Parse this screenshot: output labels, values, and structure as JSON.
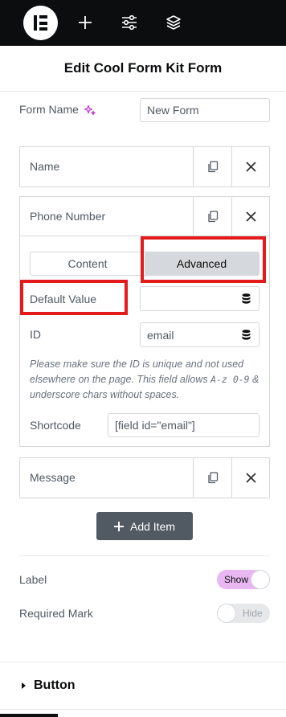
{
  "toolbar": {
    "logo": "elementor-logo-icon",
    "add_icon": "plus-icon",
    "settings_icon": "sliders-icon",
    "structure_icon": "layers-icon"
  },
  "panel_title": "Edit Cool Form Kit Form",
  "form_name": {
    "label": "Form Name",
    "ai_icon": "sparkle-icon",
    "value": "New Form"
  },
  "fields": [
    {
      "title": "Name"
    },
    {
      "title": "Phone Number"
    },
    {
      "title": "Message"
    }
  ],
  "tabs": {
    "content": "Content",
    "advanced": "Advanced",
    "active": "advanced"
  },
  "default_value": {
    "label": "Default Value",
    "value": ""
  },
  "id_field": {
    "label": "ID",
    "value": "email"
  },
  "help_text": {
    "part1": "Please make sure the ID is unique and not used elsewhere on the page. This field allows ",
    "code1": "A-z 0-9",
    "part2": " & underscore chars without spaces."
  },
  "shortcode": {
    "label": "Shortcode",
    "value": "[field id=\"email\"]"
  },
  "add_item": "Add Item",
  "label_setting": {
    "label": "Label",
    "state": "Show"
  },
  "required_setting": {
    "label": "Required Mark",
    "state": "Hide"
  },
  "section": {
    "title": "Button"
  },
  "colors": {
    "highlight": "#e31b1b",
    "switch_on": "#e9b8f2",
    "toolbar": "#0c0d0e"
  }
}
